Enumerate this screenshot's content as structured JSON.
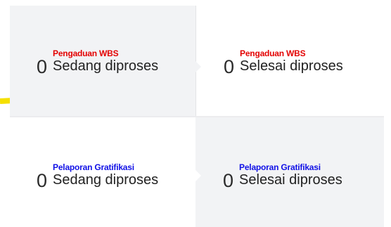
{
  "accent_colors": {
    "wbs_category": "#e30000",
    "gratifikasi_category": "#1010e6",
    "highlight_stroke": "#f5e000"
  },
  "cards": [
    {
      "count": "0",
      "category": "Pengaduan WBS",
      "status": "Sedang diproses"
    },
    {
      "count": "0",
      "category": "Pengaduan WBS",
      "status": "Selesai diproses"
    },
    {
      "count": "0",
      "category": "Pelaporan Gratifikasi",
      "status": "Sedang diproses"
    },
    {
      "count": "0",
      "category": "Pelaporan Gratifikasi",
      "status": "Selesai diproses"
    }
  ]
}
